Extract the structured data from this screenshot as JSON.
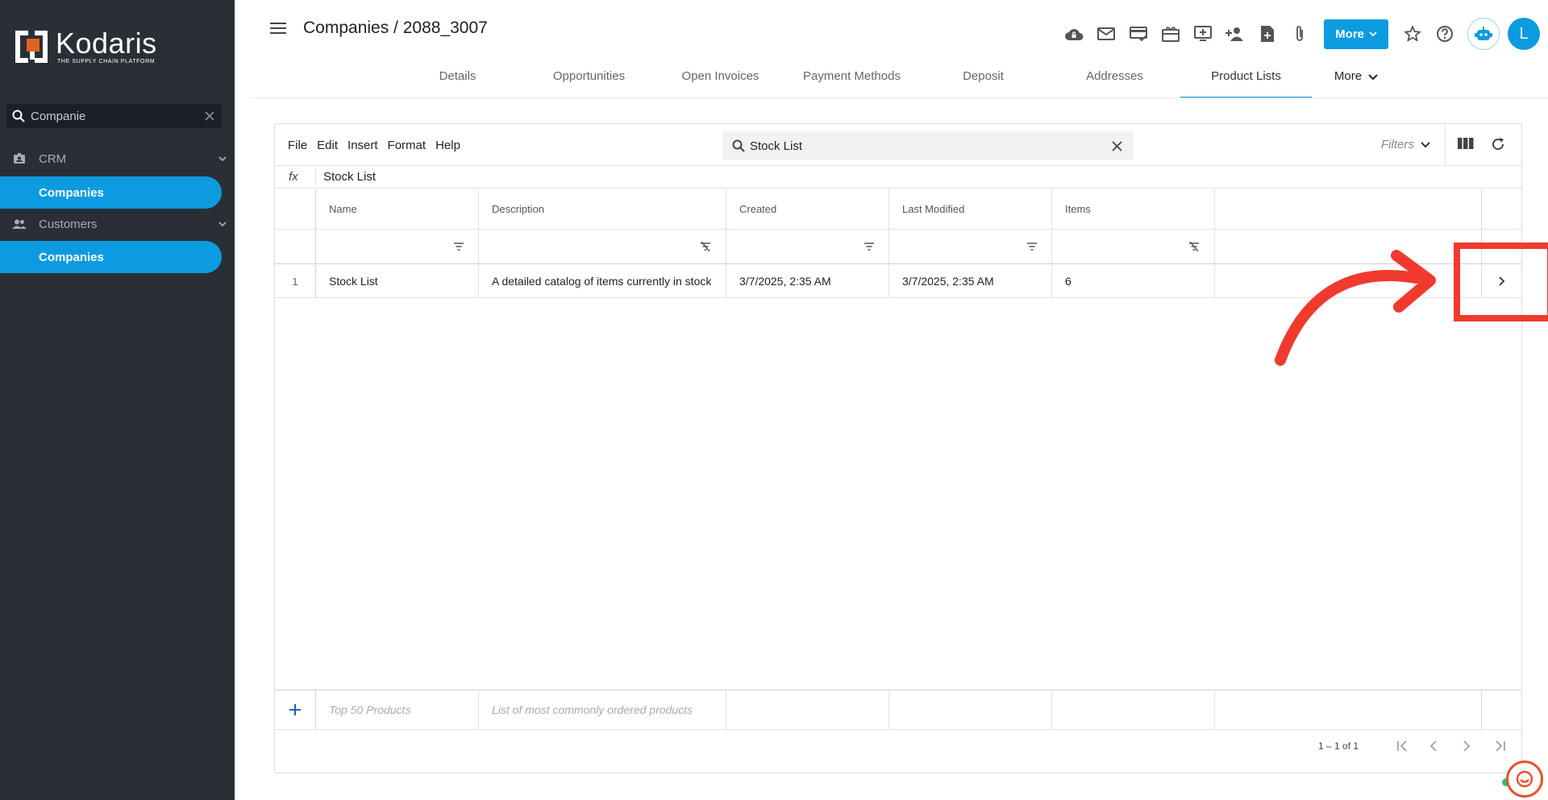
{
  "sidebar": {
    "logo_name": "Kodaris",
    "logo_tagline": "THE SUPPLY CHAIN PLATFORM",
    "search_value": "Companie",
    "groups": [
      {
        "label": "CRM",
        "icon": "contact-card-icon",
        "item": "Companies"
      },
      {
        "label": "Customers",
        "icon": "people-icon",
        "item": "Companies"
      }
    ]
  },
  "header": {
    "title": "Companies / 2088_3007",
    "more_label": "More",
    "avatar_initial": "L",
    "icons": [
      "cloud-lock-icon",
      "mail-icon",
      "card-check-icon",
      "gift-card-icon",
      "screen-add-icon",
      "add-person-icon",
      "add-document-icon",
      "attachment-icon"
    ],
    "tabs": [
      {
        "label": "Details"
      },
      {
        "label": "Opportunities"
      },
      {
        "label": "Open Invoices"
      },
      {
        "label": "Payment Methods"
      },
      {
        "label": "Deposit"
      },
      {
        "label": "Addresses"
      },
      {
        "label": "Product Lists",
        "active": true
      }
    ],
    "tabs_more": "More"
  },
  "sheet": {
    "menus": [
      "File",
      "Edit",
      "Insert",
      "Format",
      "Help"
    ],
    "search_value": "Stock List",
    "filters_label": "Filters",
    "fx_label": "fx",
    "fx_value": "Stock List",
    "columns": [
      "Name",
      "Description",
      "Created",
      "Last Modified",
      "Items"
    ],
    "rows": [
      {
        "num": "1",
        "name": "Stock List",
        "description": "A detailed catalog of items currently in stock",
        "created": "3/7/2025, 2:35 AM",
        "modified": "3/7/2025, 2:35 AM",
        "items": "6"
      }
    ],
    "new_row": {
      "name_placeholder": "Top 50 Products",
      "description_placeholder": "List of most commonly ordered products"
    },
    "pager_text": "1 – 1 of 1"
  },
  "colors": {
    "accent": "#0d9be0",
    "sidebar_bg": "#2a2f36",
    "annotation": "#f03a2e"
  }
}
